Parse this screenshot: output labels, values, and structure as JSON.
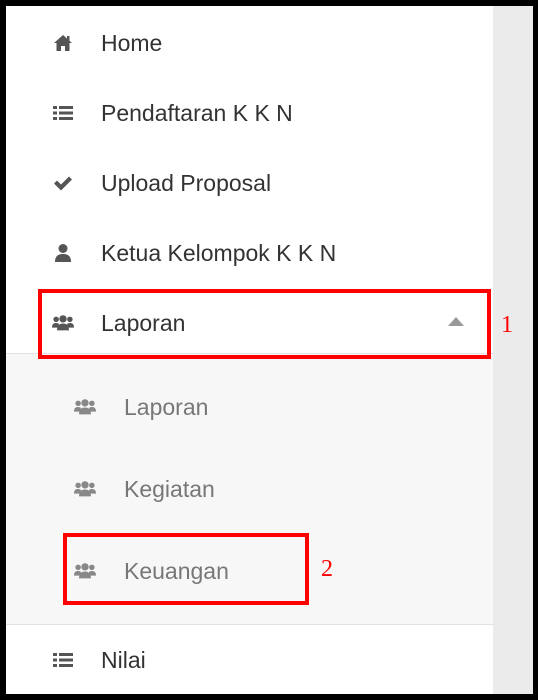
{
  "sidebar": {
    "menu": [
      {
        "label": "Home",
        "icon": "home-icon"
      },
      {
        "label": "Pendaftaran K K N",
        "icon": "list-icon"
      },
      {
        "label": "Upload Proposal",
        "icon": "check-icon"
      },
      {
        "label": "Ketua Kelompok K K N",
        "icon": "user-icon"
      },
      {
        "label": "Laporan",
        "icon": "users-icon",
        "expanded": true
      }
    ],
    "submenu": [
      {
        "label": "Laporan",
        "icon": "users-icon"
      },
      {
        "label": "Kegiatan",
        "icon": "users-icon"
      },
      {
        "label": "Keuangan",
        "icon": "users-icon"
      }
    ],
    "bottom": {
      "label": "Nilai",
      "icon": "list-icon"
    }
  },
  "annotations": {
    "first": "1",
    "second": "2",
    "color": "#ff0000"
  },
  "colors": {
    "icon": "#555555",
    "submenu_icon": "#888888",
    "text": "#333333",
    "submenu_text": "#777777"
  }
}
